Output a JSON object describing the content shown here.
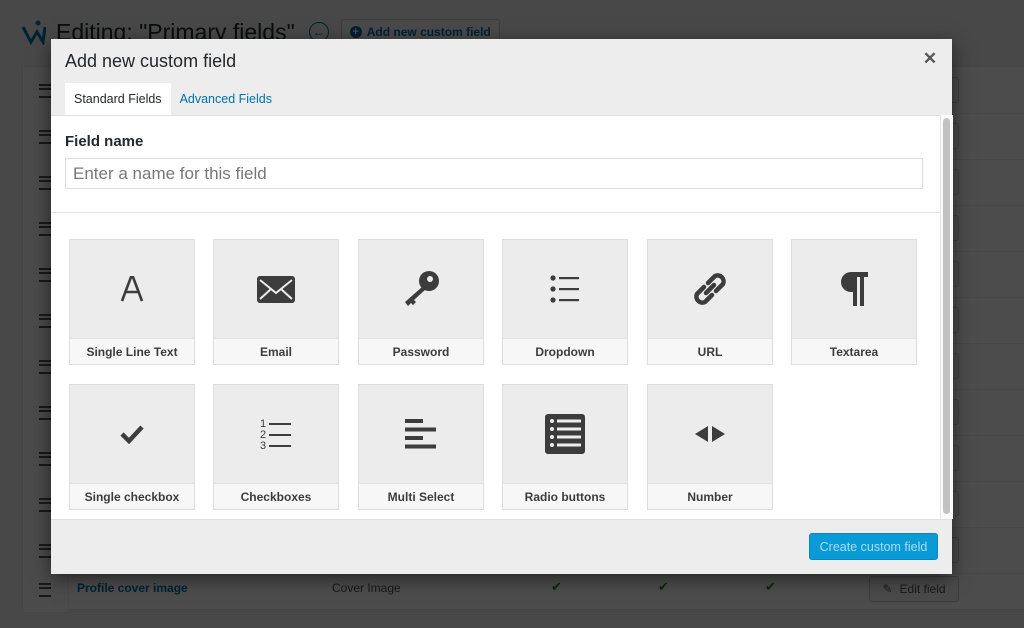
{
  "background": {
    "page_title": "Editing: \"Primary fields\"",
    "back_icon": "arrow-left-icon",
    "add_button_label": "Add new custom field",
    "last_row": {
      "field_name": "Profile cover image",
      "field_type": "Cover Image",
      "checks": [
        "✔",
        "✔",
        "✔"
      ],
      "edit_label": "Edit field"
    }
  },
  "modal": {
    "title": "Add new custom field",
    "close_glyph": "✕",
    "tabs": [
      {
        "label": "Standard Fields",
        "active": true
      },
      {
        "label": "Advanced Fields",
        "active": false
      }
    ],
    "field_name": {
      "label": "Field name",
      "placeholder": "Enter a name for this field",
      "value": ""
    },
    "field_types": [
      {
        "label": "Single Line Text",
        "icon": "letter-a-icon"
      },
      {
        "label": "Email",
        "icon": "envelope-icon"
      },
      {
        "label": "Password",
        "icon": "key-icon"
      },
      {
        "label": "Dropdown",
        "icon": "bullet-list-icon"
      },
      {
        "label": "URL",
        "icon": "link-icon"
      },
      {
        "label": "Textarea",
        "icon": "paragraph-icon"
      },
      {
        "label": "Single checkbox",
        "icon": "checkmark-icon"
      },
      {
        "label": "Checkboxes",
        "icon": "numbered-list-icon"
      },
      {
        "label": "Multi Select",
        "icon": "align-left-icon"
      },
      {
        "label": "Radio buttons",
        "icon": "list-box-icon"
      },
      {
        "label": "Number",
        "icon": "arrows-left-right-icon"
      }
    ],
    "create_button_label": "Create custom field",
    "colors": {
      "primary_button": "#0a9ad6",
      "link": "#0073aa"
    }
  }
}
